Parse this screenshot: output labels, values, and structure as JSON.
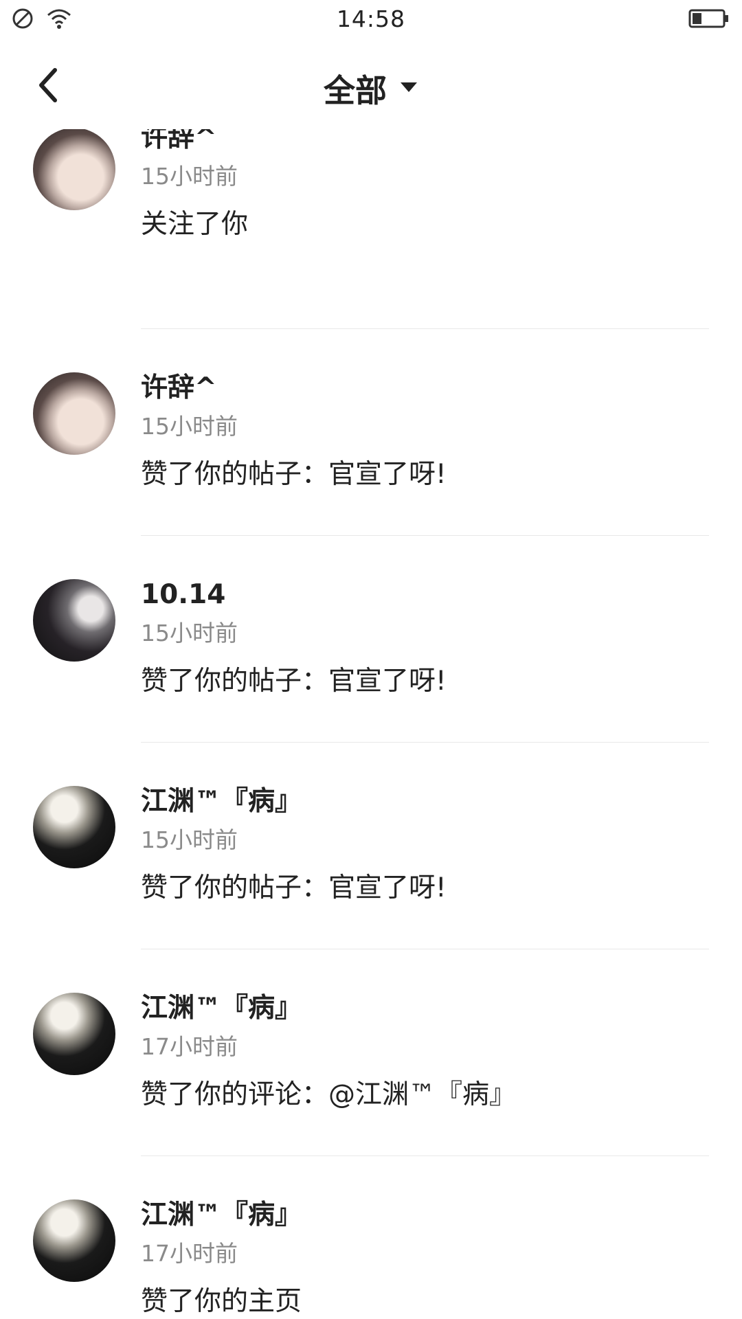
{
  "status_bar": {
    "time": "14:58",
    "icons": [
      "no-signal-icon",
      "wifi-icon",
      "battery-icon"
    ]
  },
  "nav": {
    "back_icon": "chevron-left-icon",
    "title": "全部",
    "dropdown_icon": "caret-down-icon"
  },
  "notifications": [
    {
      "user": "许辞^",
      "time": "15小时前",
      "action": "关注了你",
      "avatar": "avatar-a"
    },
    {
      "user": "许辞^",
      "time": "15小时前",
      "action": "赞了你的帖子：官宣了呀!",
      "avatar": "avatar-a"
    },
    {
      "user": "10.14",
      "time": "15小时前",
      "action": "赞了你的帖子：官宣了呀!",
      "avatar": "avatar-b"
    },
    {
      "user": "江渊™『病』",
      "time": "15小时前",
      "action": "赞了你的帖子：官宣了呀!",
      "avatar": "avatar-c"
    },
    {
      "user": "江渊™『病』",
      "time": "17小时前",
      "action": "赞了你的评论：@江渊™『病』",
      "avatar": "avatar-c"
    },
    {
      "user": "江渊™『病』",
      "time": "17小时前",
      "action": "赞了你的主页",
      "avatar": "avatar-c"
    }
  ]
}
